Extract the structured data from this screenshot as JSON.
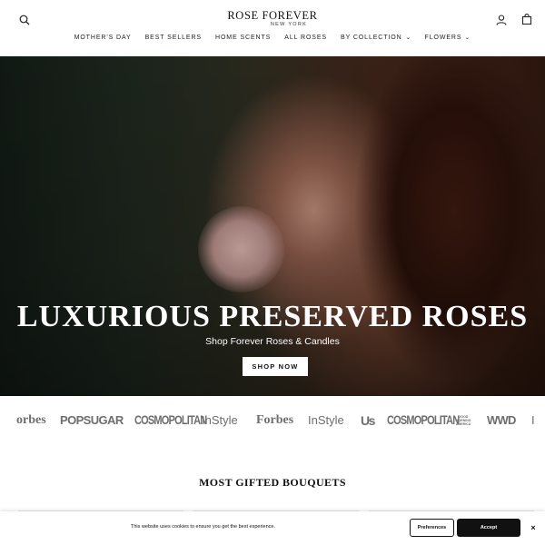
{
  "header": {
    "logo_main": "ROSE FOREVER",
    "logo_sub": "NEW YORK",
    "search_icon": "search-icon",
    "account_icon": "user-icon",
    "cart_icon": "bag-icon"
  },
  "nav": {
    "items": [
      {
        "label": "MOTHER'S DAY",
        "has_dropdown": false
      },
      {
        "label": "BEST SELLERS",
        "has_dropdown": false
      },
      {
        "label": "HOME SCENTS",
        "has_dropdown": false
      },
      {
        "label": "ALL ROSES",
        "has_dropdown": false
      },
      {
        "label": "BY COLLECTION",
        "has_dropdown": true
      },
      {
        "label": "FLOWERS",
        "has_dropdown": true
      }
    ],
    "chevron": "⌄"
  },
  "hero": {
    "title": "LUXURIOUS PRESERVED ROSES",
    "subtitle": "Shop Forever Roses & Candles",
    "cta": "SHOP NOW"
  },
  "press": {
    "logos": [
      "orbes",
      "POPSUGAR",
      "COSMOPOLITAN",
      "InStyle",
      "Forbes",
      "InStyle",
      "Us",
      "COSMOPOLITAN",
      "GOOD MORNING AMERICA",
      "WWD",
      "I"
    ]
  },
  "section": {
    "title": "MOST GIFTED BOUQUETS"
  },
  "cookie": {
    "text": "This website uses cookies to ensure you get the best experience.",
    "preferences": "Preferences",
    "accept": "Accept",
    "close": "×"
  },
  "colors": {
    "accent": "#111111",
    "press_gray": "#6e6e6e",
    "background": "#ffffff"
  }
}
